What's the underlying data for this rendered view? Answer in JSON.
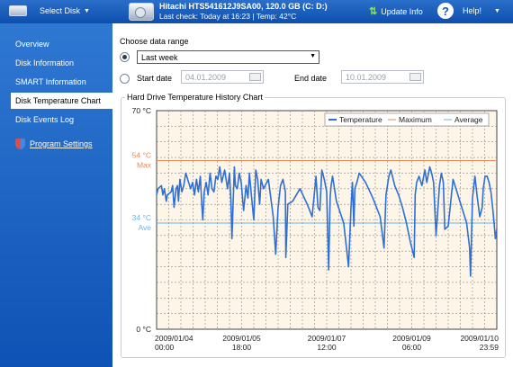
{
  "header": {
    "select_disk_label": "Select Disk",
    "disk_title": "Hitachi HTS541612J9SA00, 120.0 GB (C: D:)",
    "disk_status": "Last check: Today at 16:23 | Temp: 42°C",
    "update_info_label": "Update Info",
    "help_label": "Help!"
  },
  "sidebar": {
    "items": [
      {
        "label": "Overview"
      },
      {
        "label": "Disk Information"
      },
      {
        "label": "SMART Information"
      },
      {
        "label": "Disk Temperature Chart"
      },
      {
        "label": "Disk Events Log"
      },
      {
        "label": "Program Settings"
      }
    ]
  },
  "range": {
    "heading": "Choose data range",
    "preset_value": "Last week",
    "start_label": "Start date",
    "start_value": "04.01.2009",
    "end_label": "End date",
    "end_value": "10.01.2009"
  },
  "chart_section": {
    "title": "Hard Drive Temperature History Chart"
  },
  "chart_data": {
    "type": "line",
    "ylim": [
      0,
      70
    ],
    "y_ticks": [
      "70 °C",
      "0 °C"
    ],
    "x_ticks": [
      {
        "day": 0,
        "line1": "2009/01/04",
        "line2": "00:00"
      },
      {
        "day": 1.75,
        "line1": "2009/01/05",
        "line2": "18:00"
      },
      {
        "day": 3.5,
        "line1": "2009/01/07",
        "line2": "12:00"
      },
      {
        "day": 5.25,
        "line1": "2009/01/09",
        "line2": "06:00"
      },
      {
        "day": 6.9993,
        "line1": "2009/01/10",
        "line2": "23:59"
      }
    ],
    "maximum": {
      "value": 54,
      "label1": "54 °C",
      "label2": "Max"
    },
    "average": {
      "value": 34,
      "label1": "34 °C",
      "label2": "Ave"
    },
    "legend": [
      "Temperature",
      "Maximum",
      "Average"
    ],
    "colors": {
      "temperature": "#2e6fd6",
      "maximum": "#e58b5c",
      "average": "#6fb1e8",
      "plot_bg": "#fdf6e8",
      "grid": "#8a8a8a"
    },
    "series": [
      {
        "name": "Temperature",
        "x_days": [
          0.0,
          0.03,
          0.1,
          0.13,
          0.16,
          0.2,
          0.22,
          0.3,
          0.33,
          0.36,
          0.4,
          0.43,
          0.45,
          0.48,
          0.52,
          0.56,
          0.6,
          0.66,
          0.7,
          0.74,
          0.78,
          0.82,
          0.86,
          0.9,
          0.93,
          0.95,
          0.98,
          1.02,
          1.06,
          1.1,
          1.14,
          1.18,
          1.22,
          1.26,
          1.3,
          1.34,
          1.4,
          1.46,
          1.5,
          1.53,
          1.55,
          1.6,
          1.62,
          1.66,
          1.7,
          1.74,
          1.79,
          1.84,
          1.88,
          1.91,
          1.95,
          2.0,
          2.04,
          2.08,
          2.12,
          2.15,
          2.2,
          2.3,
          2.4,
          2.45,
          2.5,
          2.55,
          2.6,
          2.65,
          2.66,
          2.7,
          2.8,
          2.95,
          3.1,
          3.2,
          3.28,
          3.32,
          3.36,
          3.4,
          3.45,
          3.5,
          3.54,
          3.57,
          3.59,
          3.62,
          3.7,
          3.85,
          3.95,
          4.0,
          4.03,
          4.06,
          4.08,
          4.12,
          4.17,
          4.3,
          4.45,
          4.6,
          4.68,
          4.72,
          4.75,
          4.78,
          4.82,
          4.9,
          4.98,
          5.06,
          5.14,
          5.22,
          5.3,
          5.32,
          5.35,
          5.4,
          5.46,
          5.52,
          5.56,
          5.62,
          5.66,
          5.7,
          5.75,
          5.82,
          5.86,
          5.9,
          5.93,
          6.0,
          6.1,
          6.2,
          6.3,
          6.38,
          6.44,
          6.46,
          6.5,
          6.55,
          6.6,
          6.65,
          6.7,
          6.72,
          6.76,
          6.8,
          6.84,
          6.88,
          6.92,
          6.95,
          6.97,
          7.0
        ],
        "temps": [
          43,
          45,
          46,
          43,
          45,
          41,
          43,
          44,
          46,
          39,
          45,
          46,
          41,
          48,
          44,
          46,
          50,
          47,
          45,
          47,
          43,
          48,
          44,
          49,
          40,
          35,
          44,
          47,
          43,
          50,
          45,
          44,
          49,
          48,
          52,
          47,
          51,
          45,
          50,
          41,
          29,
          52,
          46,
          45,
          50,
          47,
          38,
          46,
          42,
          50,
          43,
          35,
          51,
          48,
          40,
          48,
          45,
          48,
          36,
          24,
          39,
          46,
          48,
          44,
          23,
          40,
          41,
          45,
          40,
          36,
          49,
          39,
          38,
          51,
          48,
          44,
          19,
          42,
          46,
          49,
          41,
          34,
          20,
          39,
          47,
          33,
          45,
          47,
          50,
          47,
          42,
          36,
          26,
          43,
          46,
          49,
          51,
          46,
          43,
          39,
          34,
          28,
          23,
          43,
          47,
          49,
          46,
          51,
          47,
          52,
          50,
          47,
          30,
          46,
          50,
          47,
          32,
          33,
          48,
          43,
          38,
          34,
          26,
          17,
          42,
          49,
          42,
          36,
          39,
          45,
          49,
          49,
          47,
          44,
          38,
          33,
          29,
          32,
          39,
          42
        ]
      }
    ]
  }
}
